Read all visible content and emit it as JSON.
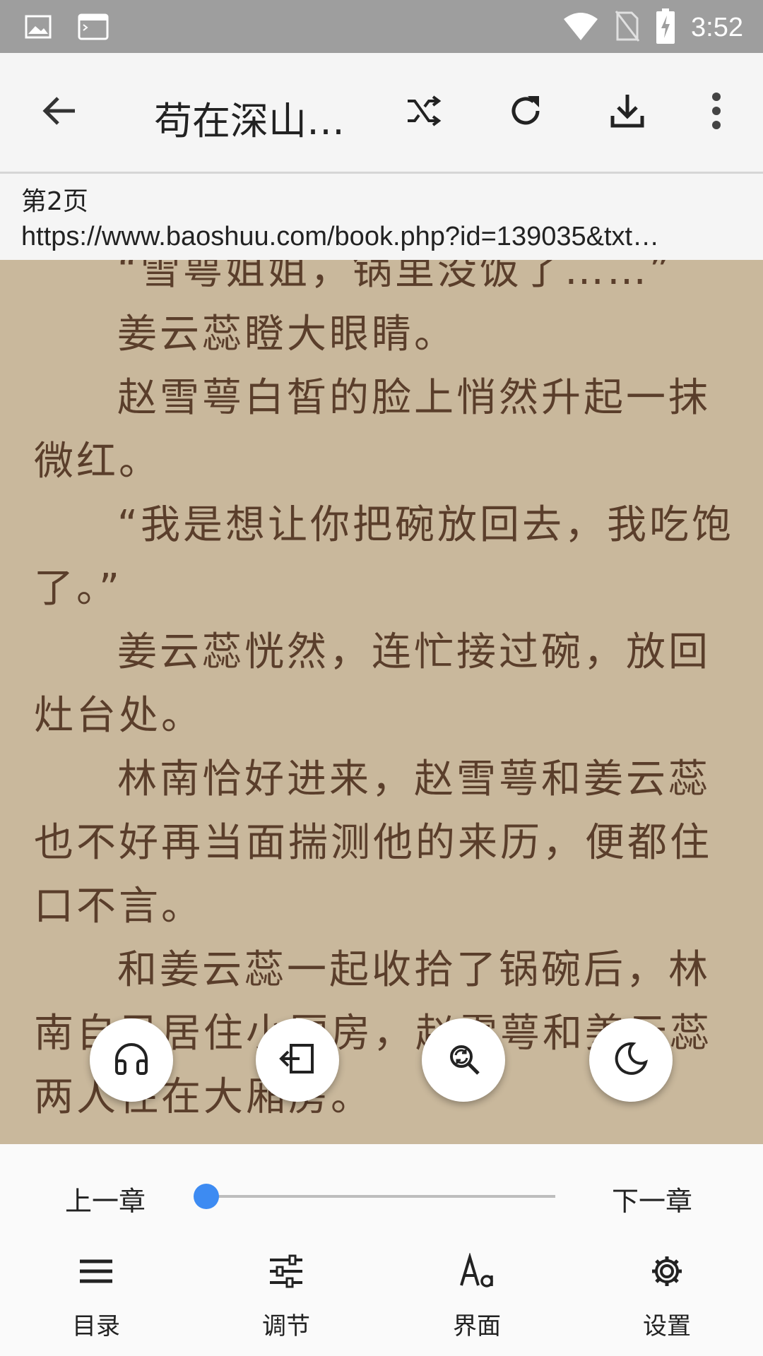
{
  "status_bar": {
    "time": "3:52",
    "left_icons": [
      "image-icon",
      "terminal-icon"
    ],
    "right_icons": [
      "wifi-icon",
      "no-sim-icon",
      "battery-charging-icon"
    ]
  },
  "toolbar": {
    "title": "苟在深山…",
    "icons": [
      "back-arrow-icon",
      "shuffle-icon",
      "refresh-icon",
      "download-icon",
      "more-vert-icon"
    ]
  },
  "page_info": {
    "page": "第2页",
    "url": "https://www.baoshuu.com/book.php?id=139035&txt…"
  },
  "content": {
    "lines": [
      {
        "text": "“雪萼姐姐，锅里没饭了……”",
        "indent": true
      },
      {
        "text": "姜云蕊瞪大眼睛。",
        "indent": true
      },
      {
        "text": "赵雪萼白皙的脸上悄然升起一抹",
        "indent": true
      },
      {
        "text": "微红。",
        "indent": false
      },
      {
        "text": "“我是想让你把碗放回去，我吃饱",
        "indent": true
      },
      {
        "text": "了。”",
        "indent": false
      },
      {
        "text": "姜云蕊恍然，连忙接过碗，放回",
        "indent": true
      },
      {
        "text": "灶台处。",
        "indent": false
      },
      {
        "text": "林南恰好进来，赵雪萼和姜云蕊",
        "indent": true
      },
      {
        "text": "也不好再当面揣测他的来历，便都住",
        "indent": false
      },
      {
        "text": "口不言。",
        "indent": false
      },
      {
        "text": "和姜云蕊一起收拾了锅碗后，林",
        "indent": true
      },
      {
        "text": "南自己居住小厢房，赵雪萼和姜云蕊",
        "indent": false
      },
      {
        "text": "两人住在大厢房。",
        "indent": false
      }
    ]
  },
  "fabs": [
    "headphones-icon",
    "exit-icon",
    "search-replace-icon",
    "moon-icon"
  ],
  "bottom": {
    "prev_chapter": "上一章",
    "next_chapter": "下一章",
    "progress": 0.0,
    "menu": [
      {
        "label": "目录",
        "icon": "list-icon"
      },
      {
        "label": "调节",
        "icon": "tune-icon"
      },
      {
        "label": "界面",
        "icon": "font-icon"
      },
      {
        "label": "设置",
        "icon": "gear-icon"
      }
    ]
  },
  "colors": {
    "reading_bg": "#c9b89c",
    "text": "#5a3e2b",
    "accent": "#3d8bf2"
  }
}
